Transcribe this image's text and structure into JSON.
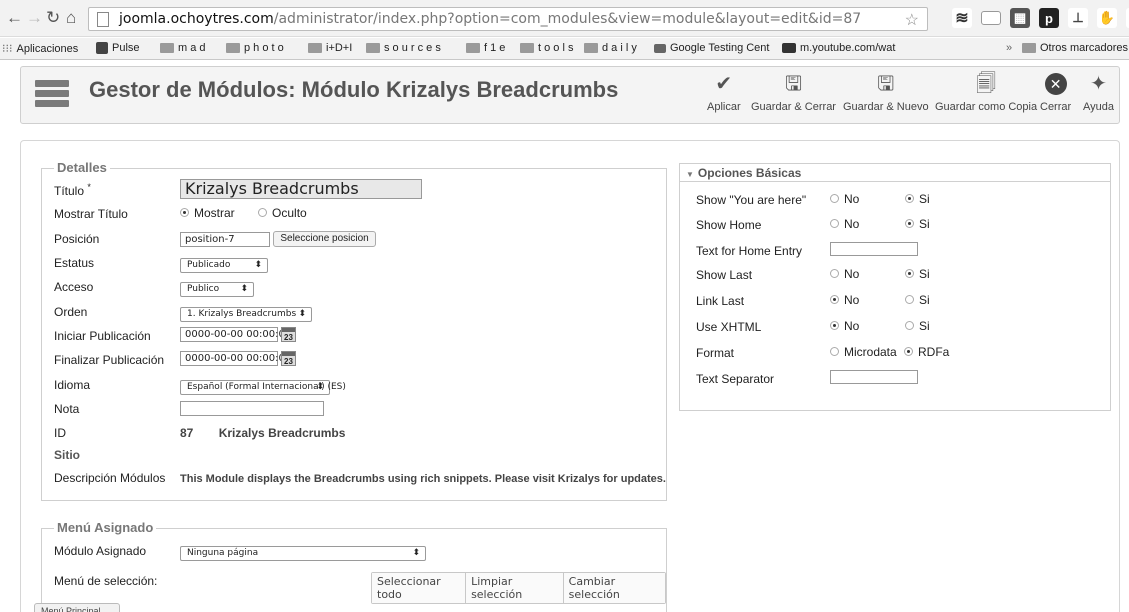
{
  "browser": {
    "url_domain": "joomla.ochoytres.com",
    "url_path": "/administrator/index.php?option=com_modules&view=module&layout=edit&id=87",
    "bookmarks": [
      {
        "label": "Aplicaciones"
      },
      {
        "label": "Pulse"
      },
      {
        "label": "m a d"
      },
      {
        "label": "p h o t o"
      },
      {
        "label": "i+D+I"
      },
      {
        "label": "s o u r c e s"
      },
      {
        "label": "f 1 e"
      },
      {
        "label": "t o o l s"
      },
      {
        "label": "d a i l y"
      },
      {
        "label": "Google Testing Cent"
      },
      {
        "label": "m.youtube.com/wat"
      }
    ],
    "bookmarks_more": "»",
    "other_bookmarks": "Otros marcadores"
  },
  "toolbar": {
    "title": "Gestor de Módulos: Módulo Krizalys Breadcrumbs",
    "buttons": {
      "apply": "Aplicar",
      "save_close": "Guardar & Cerrar",
      "save_new": "Guardar & Nuevo",
      "save_copy": "Guardar como Copia",
      "close": "Cerrar",
      "help": "Ayuda"
    }
  },
  "details": {
    "legend": "Detalles",
    "title_label": "Título",
    "title_required": "*",
    "title_value": "Krizalys Breadcrumbs",
    "show_title_label": "Mostrar Título",
    "show_title_on": "Mostrar",
    "show_title_off": "Oculto",
    "position_label": "Posición",
    "position_value": "position-7",
    "position_button": "Seleccione posicion",
    "status_label": "Estatus",
    "status_value": "Publicado",
    "access_label": "Acceso",
    "access_value": "Publico",
    "order_label": "Orden",
    "order_value": "1. Krizalys Breadcrumbs",
    "publish_up_label": "Iniciar Publicación",
    "publish_up_value": "0000-00-00 00:00:0",
    "publish_down_label": "Finalizar Publicación",
    "publish_down_value": "0000-00-00 00:00:0",
    "calendar_day": "23",
    "language_label": "Idioma",
    "language_value": "Español (Formal Internacional) (ES)",
    "note_label": "Nota",
    "note_value": "",
    "id_label": "ID",
    "id_value": "87",
    "id_name": "Krizalys Breadcrumbs",
    "site_label": "Sitio",
    "description_label": "Descripción Módulos",
    "description_value": "This Module displays the Breadcrumbs using rich snippets. Please visit Krizalys for updates."
  },
  "menu_assignment": {
    "legend": "Menú Asignado",
    "assigned_label": "Módulo Asignado",
    "assigned_value": "Ninguna página",
    "selection_label": "Menú de selección:",
    "select_all": "Seleccionar todo",
    "clear_selection": "Limpiar selección",
    "toggle_selection": "Cambiar selección",
    "menu_tab": "Menú Principal"
  },
  "basic_options": {
    "header": "Opciones Básicas",
    "rows": [
      {
        "label": "Show \"You are here\"",
        "opt1": "No",
        "opt2": "Si",
        "selected": 2
      },
      {
        "label": "Show Home",
        "opt1": "No",
        "opt2": "Si",
        "selected": 2
      },
      {
        "label": "Text for Home Entry",
        "input": ""
      },
      {
        "label": "Show Last",
        "opt1": "No",
        "opt2": "Si",
        "selected": 2
      },
      {
        "label": "Link Last",
        "opt1": "No",
        "opt2": "Si",
        "selected": 1
      },
      {
        "label": "Use XHTML",
        "opt1": "No",
        "opt2": "Si",
        "selected": 1
      },
      {
        "label": "Format",
        "opt1": "Microdata",
        "opt2": "RDFa",
        "selected": 2
      },
      {
        "label": "Text Separator",
        "input": ""
      }
    ]
  }
}
